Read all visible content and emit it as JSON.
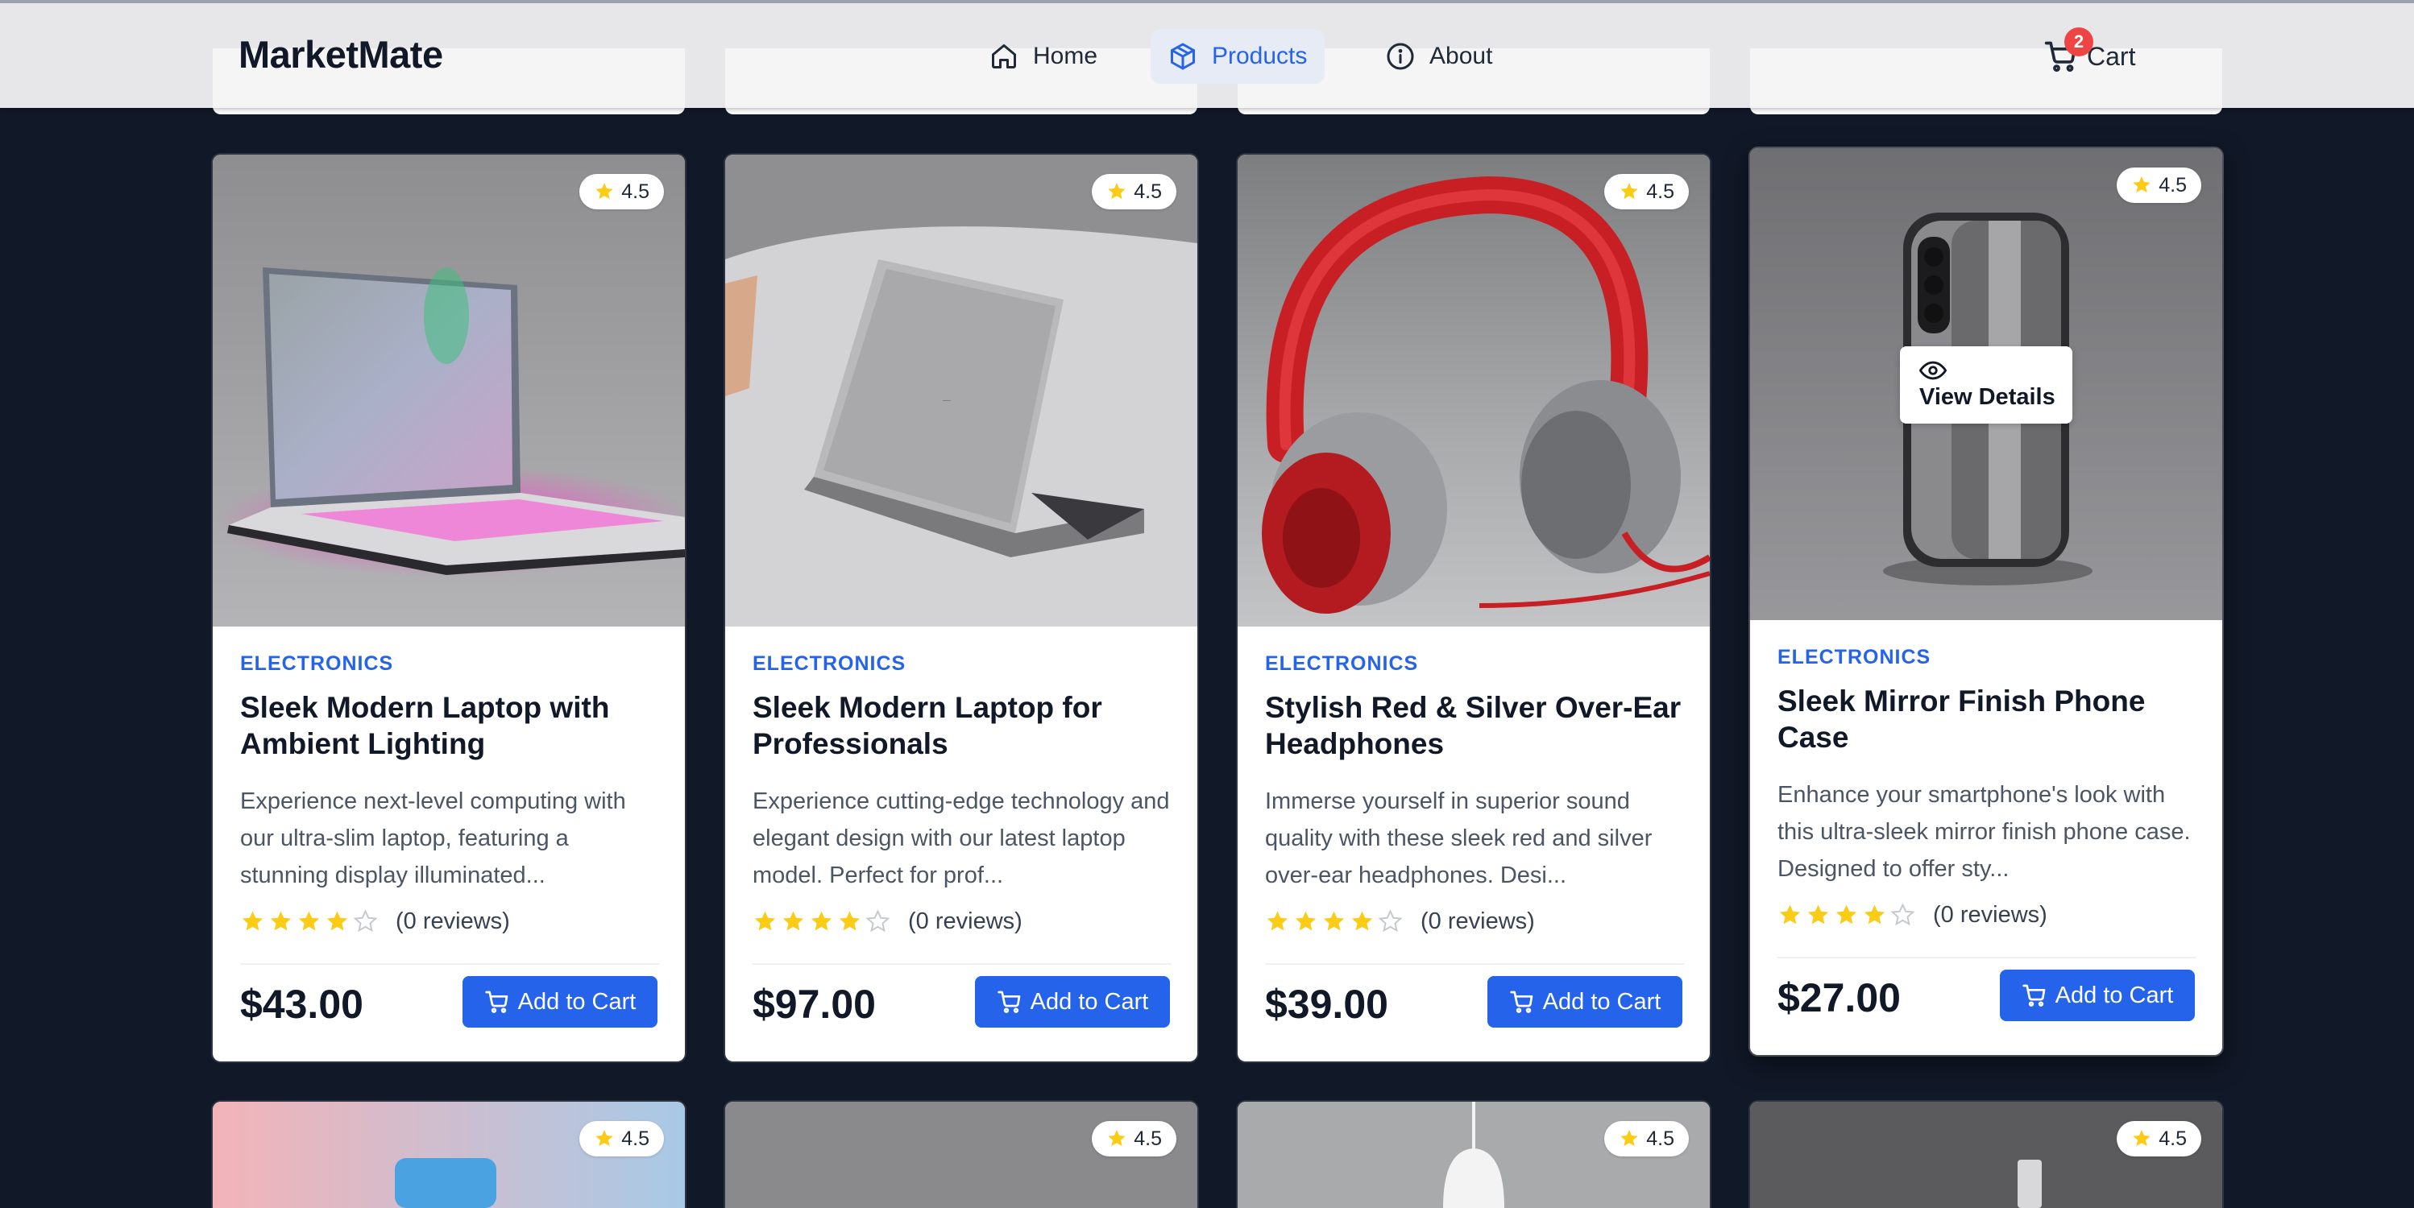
{
  "brand": "MarketMate",
  "nav": {
    "home": "Home",
    "products": "Products",
    "about": "About",
    "cart": "Cart",
    "cart_count": "2"
  },
  "cards": [
    {
      "rating": "4.5",
      "category": "ELECTRONICS",
      "title": "Sleek Modern Laptop with Ambient Lighting",
      "description": "Experience next-level computing with our ultra-slim laptop, featuring a stunning display illuminated...",
      "reviews": "(0 reviews)",
      "stars": 4,
      "price": "$43.00",
      "add_label": "Add to Cart",
      "image_icon": "laptop-ambient-image"
    },
    {
      "rating": "4.5",
      "category": "ELECTRONICS",
      "title": "Sleek Modern Laptop for Professionals",
      "description": "Experience cutting-edge technology and elegant design with our latest laptop model. Perfect for prof...",
      "reviews": "(0 reviews)",
      "stars": 4,
      "price": "$97.00",
      "add_label": "Add to Cart",
      "image_icon": "laptop-silver-image"
    },
    {
      "rating": "4.5",
      "category": "ELECTRONICS",
      "title": "Stylish Red & Silver Over-Ear Headphones",
      "description": "Immerse yourself in superior sound quality with these sleek red and silver over-ear headphones. Desi...",
      "reviews": "(0 reviews)",
      "stars": 4,
      "price": "$39.00",
      "add_label": "Add to Cart",
      "image_icon": "headphones-image"
    },
    {
      "rating": "4.5",
      "category": "ELECTRONICS",
      "title": "Sleek Mirror Finish Phone Case",
      "description": "Enhance your smartphone's look with this ultra-sleek mirror finish phone case. Designed to offer sty...",
      "reviews": "(0 reviews)",
      "stars": 4,
      "price": "$27.00",
      "add_label": "Add to Cart",
      "view_details": "View Details",
      "image_icon": "phone-case-image"
    }
  ],
  "next_row_ratings": [
    "4.5",
    "4.5",
    "4.5",
    "4.5"
  ],
  "colors": {
    "accent": "#2563eb",
    "background": "#111827",
    "star": "#facc15",
    "badge": "#ef4444"
  }
}
